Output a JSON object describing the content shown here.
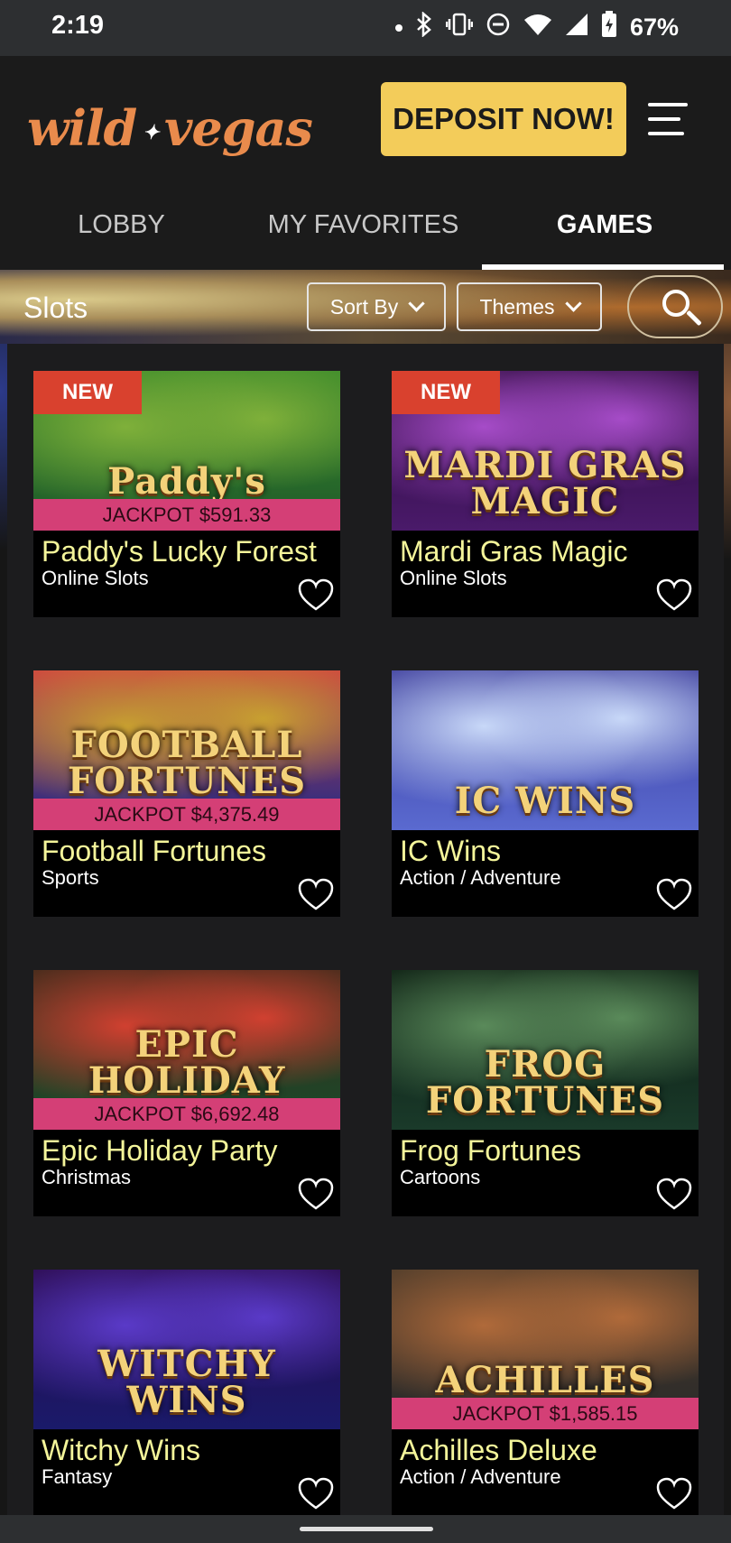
{
  "status_bar": {
    "time": "2:19",
    "battery": "67%",
    "icons": [
      "dot-icon",
      "bluetooth-icon",
      "vibrate-icon",
      "dnd-icon",
      "wifi-icon",
      "signal-icon",
      "battery-icon"
    ]
  },
  "header": {
    "logo_left": "wild",
    "logo_right": "vegas",
    "deposit_label": "DEPOSIT NOW!",
    "menu_icon": "hamburger-menu-icon"
  },
  "tabs": [
    {
      "label": "LOBBY"
    },
    {
      "label": "MY FAVORITES"
    },
    {
      "label": "GAMES",
      "active": true
    }
  ],
  "filters": {
    "heading": "Slots",
    "sort_label": "Sort By",
    "themes_label": "Themes",
    "search_icon": "search-icon"
  },
  "games": [
    {
      "title": "Paddy's Lucky Forest",
      "category": "Online Slots",
      "badge": "NEW",
      "jackpot": "JACKPOT $591.33",
      "art": "Paddy's",
      "colors": [
        "#1f5a2a",
        "#7fb03a",
        "#3a8a2a"
      ]
    },
    {
      "title": "Mardi Gras Magic",
      "category": "Online Slots",
      "badge": "NEW",
      "jackpot": "",
      "art": "MARDI GRAS MAGIC",
      "colors": [
        "#4a1a6a",
        "#a64cc8",
        "#2a0a3a"
      ]
    },
    {
      "title": "Football Fortunes",
      "category": "Sports",
      "badge": "",
      "jackpot": "JACKPOT $4,375.49",
      "art": "FOOTBALL FORTUNES",
      "colors": [
        "#1a2a8a",
        "#c8a030",
        "#d04040"
      ]
    },
    {
      "title": "IC Wins",
      "category": "Action / Adventure",
      "badge": "",
      "jackpot": "",
      "art": "IC WINS",
      "colors": [
        "#5a6ad0",
        "#c8d8f8",
        "#3a3a9a"
      ]
    },
    {
      "title": "Epic Holiday Party",
      "category": "Christmas",
      "badge": "",
      "jackpot": "JACKPOT $6,692.48",
      "art": "EPIC HOLIDAY",
      "colors": [
        "#1a4a2a",
        "#d04030",
        "#3a2a1a"
      ]
    },
    {
      "title": "Frog Fortunes",
      "category": "Cartoons",
      "badge": "",
      "jackpot": "",
      "art": "FROG FORTUNES",
      "colors": [
        "#1a3a2a",
        "#5a8a5a",
        "#0a1a10"
      ]
    },
    {
      "title": "Witchy Wins",
      "category": "Fantasy",
      "badge": "",
      "jackpot": "",
      "art": "WITCHY WINS",
      "colors": [
        "#1a1a6a",
        "#5a3ac8",
        "#2a0a4a"
      ]
    },
    {
      "title": "Achilles Deluxe",
      "category": "Action / Adventure",
      "badge": "",
      "jackpot": "JACKPOT $1,585.15",
      "art": "ACHILLES",
      "colors": [
        "#2a2a2a",
        "#b06a3a",
        "#4a3a2a"
      ]
    }
  ]
}
